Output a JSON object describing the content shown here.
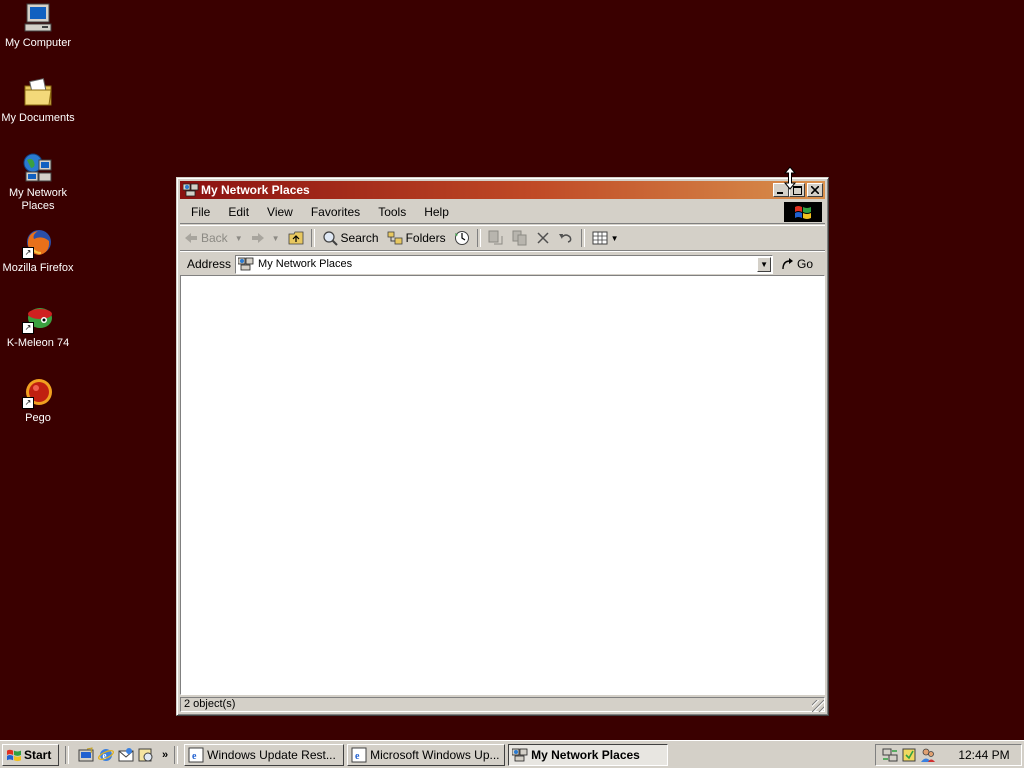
{
  "desktop": {
    "icons": [
      {
        "label": "My Computer",
        "icon": "my-computer-icon"
      },
      {
        "label": "My Documents",
        "icon": "my-documents-icon"
      },
      {
        "label": "My Network Places",
        "icon": "network-places-icon"
      },
      {
        "label": "Mozilla Firefox",
        "icon": "firefox-icon"
      },
      {
        "label": "K-Meleon 74",
        "icon": "k-meleon-icon"
      },
      {
        "label": "Pego",
        "icon": "pego-icon"
      }
    ]
  },
  "window": {
    "title": "My Network Places",
    "menu": [
      "File",
      "Edit",
      "View",
      "Favorites",
      "Tools",
      "Help"
    ],
    "toolbar": {
      "back": "Back",
      "search": "Search",
      "folders": "Folders"
    },
    "address": {
      "label": "Address",
      "value": "My Network Places",
      "go": "Go"
    },
    "status": "2 object(s)"
  },
  "taskbar": {
    "start": "Start",
    "tasks": [
      {
        "label": "Windows Update Rest...",
        "active": false
      },
      {
        "label": "Microsoft Windows Up...",
        "active": false
      },
      {
        "label": "My Network Places",
        "active": true
      }
    ],
    "clock": "12:44 PM"
  },
  "colors": {
    "desktop": "#3a0000",
    "title_start": "#8a1010",
    "title_end": "#d9914d",
    "face": "#d4d0c8"
  }
}
